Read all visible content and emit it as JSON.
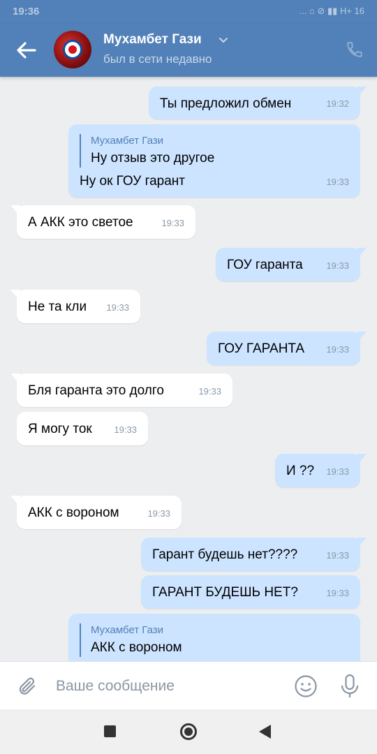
{
  "status_bar": {
    "time": "19:36",
    "indicators": "... ⌂ ⊘ ▮▮ H+ 16"
  },
  "header": {
    "contact_name": "Мухамбет Гази",
    "status": "был в сети недавно"
  },
  "messages": [
    {
      "dir": "out",
      "text": "Ты предложил обмен",
      "time": "19:32"
    },
    {
      "dir": "out",
      "reply_name": "Мухамбет Гази",
      "reply_text": "Ну отзыв это другое",
      "text": "Ну ок ГОУ гарант",
      "time": "19:33"
    },
    {
      "dir": "in",
      "text": "А АКК это светое",
      "time": "19:33"
    },
    {
      "dir": "out",
      "text": "ГОУ гаранта",
      "time": "19:33"
    },
    {
      "dir": "in",
      "text": "Не та кли",
      "time": "19:33"
    },
    {
      "dir": "out",
      "text": "ГОУ ГАРАНТА",
      "time": "19:33"
    },
    {
      "dir": "in",
      "text": "Бля гаранта это долго",
      "time": "19:33"
    },
    {
      "dir": "in",
      "text": "Я могу ток",
      "time": "19:33"
    },
    {
      "dir": "out",
      "text": "И ??",
      "time": "19:33"
    },
    {
      "dir": "in",
      "text": "АКК с вороном",
      "time": "19:33"
    },
    {
      "dir": "out",
      "text": "Гарант будешь нет????",
      "time": "19:33"
    },
    {
      "dir": "out",
      "text": "ГАРАНТ БУДЕШЬ НЕТ?",
      "time": "19:33"
    },
    {
      "dir": "out",
      "reply_name": "Мухамбет Гази",
      "reply_text": "АКК с вороном",
      "text": "",
      "time": ""
    }
  ],
  "composer": {
    "placeholder": "Ваше сообщение"
  },
  "colors": {
    "header_bg": "#5181b8",
    "chat_bg": "#edeef0",
    "incoming_bubble": "#ffffff",
    "outgoing_bubble": "#cce4ff"
  },
  "icons": [
    "back-arrow-icon",
    "chevron-down-icon",
    "phone-icon",
    "paperclip-icon",
    "smile-icon",
    "microphone-icon"
  ]
}
